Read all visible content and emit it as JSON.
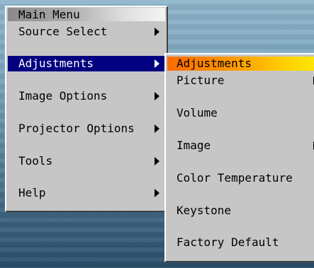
{
  "main_menu": {
    "title": "Main Menu",
    "items": [
      {
        "label": "Source Select",
        "has_submenu": true
      },
      {
        "label": "Adjustments",
        "has_submenu": true,
        "selected": true
      },
      {
        "label": "Image Options",
        "has_submenu": true
      },
      {
        "label": "Projector Options",
        "has_submenu": true
      },
      {
        "label": "Tools",
        "has_submenu": true
      },
      {
        "label": "Help",
        "has_submenu": true
      }
    ]
  },
  "submenu": {
    "title": "Adjustments",
    "items": [
      {
        "label": "Picture",
        "has_submenu": true
      },
      {
        "label": "Volume",
        "has_submenu": false
      },
      {
        "label": "Image",
        "has_submenu": true
      },
      {
        "label": "Color Temperature",
        "has_submenu": false
      },
      {
        "label": "Keystone",
        "has_submenu": false
      },
      {
        "label": "Factory Default",
        "has_submenu": false
      }
    ]
  },
  "colors": {
    "menu_bg": "#c6c6c6",
    "selection": "#000080",
    "submenu_title_gradient": [
      "#ff6a00",
      "#ffe600"
    ]
  },
  "icons": {
    "submenu_arrow": "right-triangle-icon"
  }
}
